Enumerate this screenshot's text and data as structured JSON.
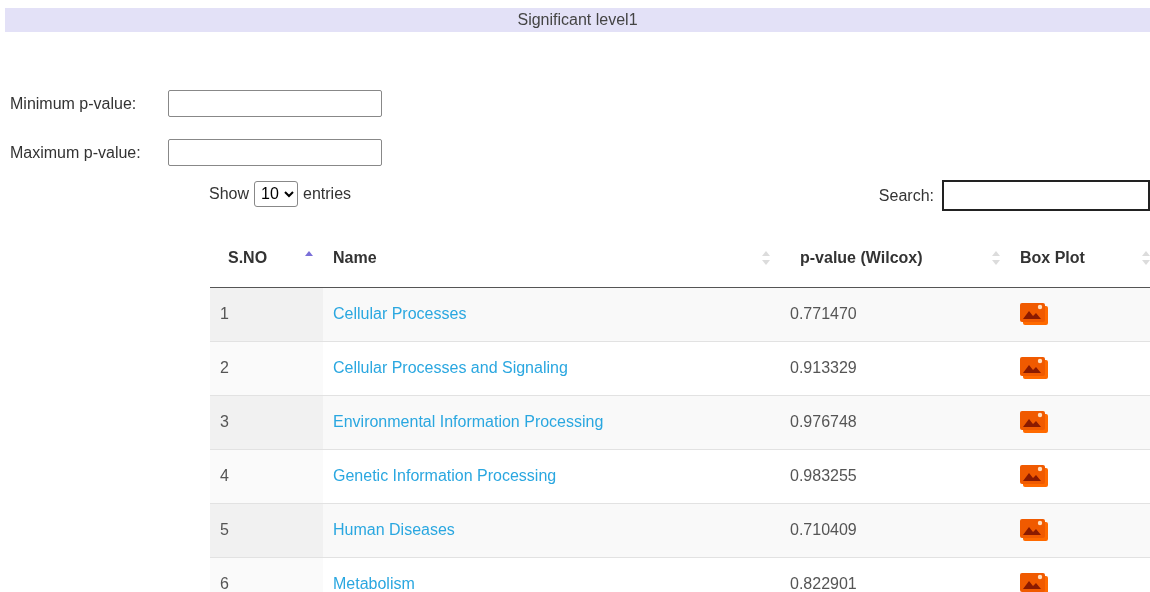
{
  "title": "Significant level1",
  "filters": [
    {
      "label": "Minimum p-value:"
    },
    {
      "label": "Maximum p-value:"
    }
  ],
  "length": {
    "before": "Show",
    "value": "10",
    "after": "entries"
  },
  "search": {
    "label": "Search:"
  },
  "columns": [
    {
      "label": "S.NO",
      "sorted_ascending": true
    },
    {
      "label": "Name",
      "sorted_ascending": false
    },
    {
      "label": "p-value (Wilcox)",
      "sorted_ascending": false
    },
    {
      "label": "Box Plot",
      "sorted_ascending": false
    }
  ],
  "rows": [
    {
      "sno": "1",
      "name": "Cellular Processes",
      "p": "0.771470"
    },
    {
      "sno": "2",
      "name": "Cellular Processes and Signaling",
      "p": "0.913329"
    },
    {
      "sno": "3",
      "name": "Environmental Information Processing",
      "p": "0.976748"
    },
    {
      "sno": "4",
      "name": "Genetic Information Processing",
      "p": "0.983255"
    },
    {
      "sno": "5",
      "name": "Human Diseases",
      "p": "0.710409"
    },
    {
      "sno": "6",
      "name": "Metabolism",
      "p": "0.822901"
    }
  ]
}
